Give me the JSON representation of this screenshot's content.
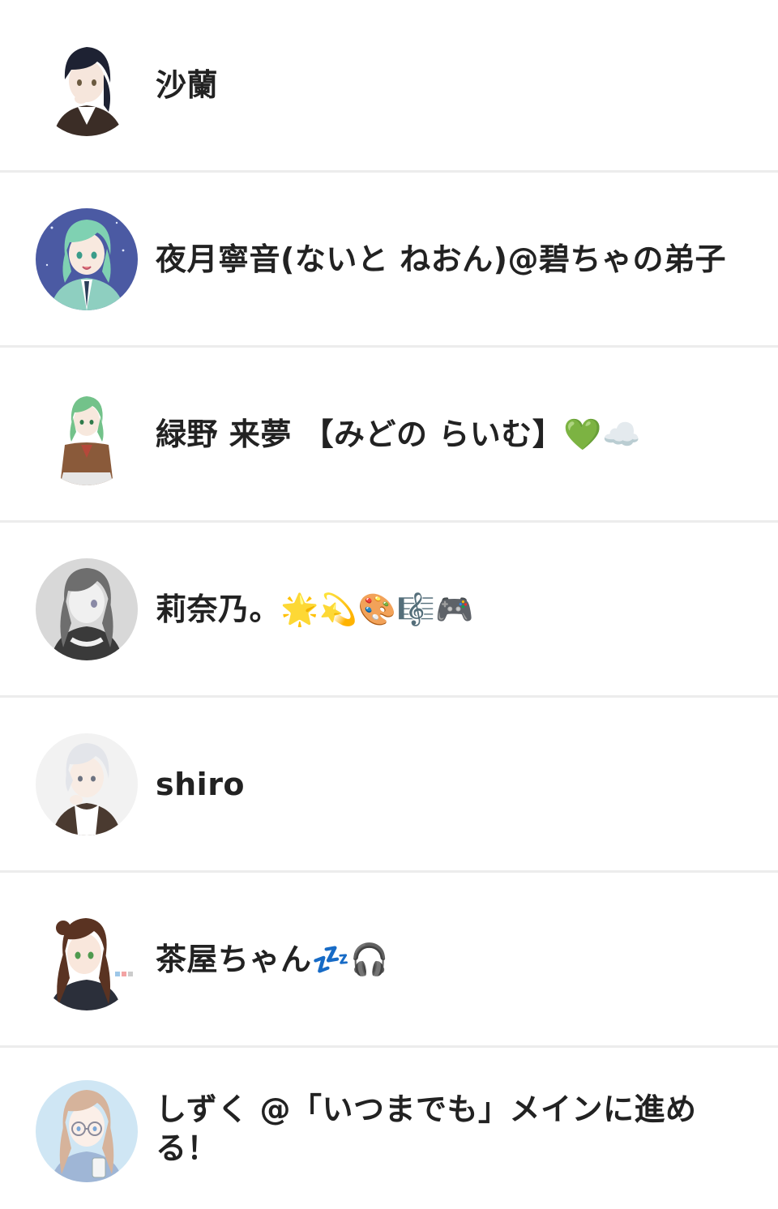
{
  "users": [
    {
      "name": "沙蘭",
      "avatar": "avatar-dark-hair-boy",
      "bg": "#ffffff",
      "hair": "#1e2233",
      "skin": "#f6e6dc",
      "cloth": "#3b2d26"
    },
    {
      "name": "夜月寧音(ないと ねおん)@碧ちゃの弟子",
      "avatar": "avatar-green-hair-boy",
      "bg": "#4b5aa3",
      "hair": "#7fd1b2",
      "skin": "#f8e9df",
      "cloth": "#8ecfc0"
    },
    {
      "name": "緑野 来夢 【みどの らいむ】💚☁️",
      "avatar": "avatar-green-hair-girl",
      "bg": "#ffffff",
      "hair": "#73c28a",
      "skin": "#f7e8dd",
      "cloth": "#8a5a3a"
    },
    {
      "name": "莉奈乃。🌟💫🎨🎼🎮",
      "avatar": "avatar-grey-hair-girl",
      "bg": "#d8d8d8",
      "hair": "#6e6e6e",
      "skin": "#f0f0f0",
      "cloth": "#3a3a3a"
    },
    {
      "name": "shiro",
      "avatar": "avatar-white-hair-boy",
      "bg": "#f2f2f2",
      "hair": "#e3e5ea",
      "skin": "#f8ece4",
      "cloth": "#4a3a30"
    },
    {
      "name": "茶屋ちゃん💤🎧",
      "avatar": "avatar-brown-hair-girl",
      "bg": "#ffffff",
      "hair": "#5a3322",
      "skin": "#f9e7dc",
      "cloth": "#2b2f3a"
    },
    {
      "name": "しずく @「いつまでも」メインに進める！",
      "avatar": "avatar-glasses-girl",
      "bg": "#cfe6f4",
      "hair": "#d6b39b",
      "skin": "#fbefe8",
      "cloth": "#9fb6d6"
    }
  ]
}
